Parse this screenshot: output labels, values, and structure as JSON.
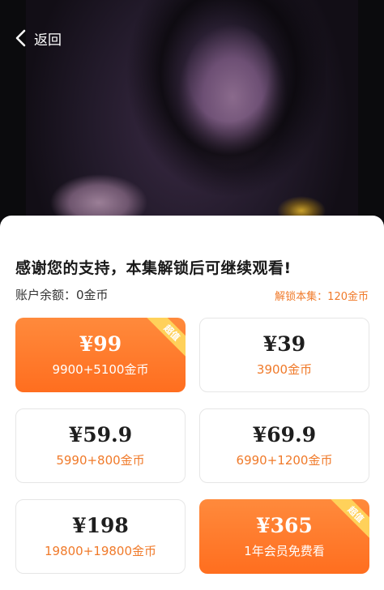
{
  "header": {
    "back_label": "返回"
  },
  "sheet": {
    "headline": "感谢您的支持，本集解锁后可继续观看!",
    "balance": "账户余额：0金币",
    "unlock_cost": "解锁本集：120金币"
  },
  "plans": [
    {
      "price": "¥99",
      "desc": "9900+5100金币",
      "badge": "超值",
      "highlighted": true
    },
    {
      "price": "¥39",
      "desc": "3900金币",
      "highlighted": false
    },
    {
      "price": "¥59.9",
      "desc": "5990+800金币",
      "highlighted": false
    },
    {
      "price": "¥69.9",
      "desc": "6990+1200金币",
      "highlighted": false
    },
    {
      "price": "¥198",
      "desc": "19800+19800金币",
      "highlighted": false
    },
    {
      "price": "¥365",
      "desc": "1年会员免费看",
      "badge": "超值",
      "highlighted": true
    }
  ],
  "colors": {
    "accent": "#ff6e1f",
    "accent_text": "#f07a2a",
    "badge": "#ffd15a"
  }
}
